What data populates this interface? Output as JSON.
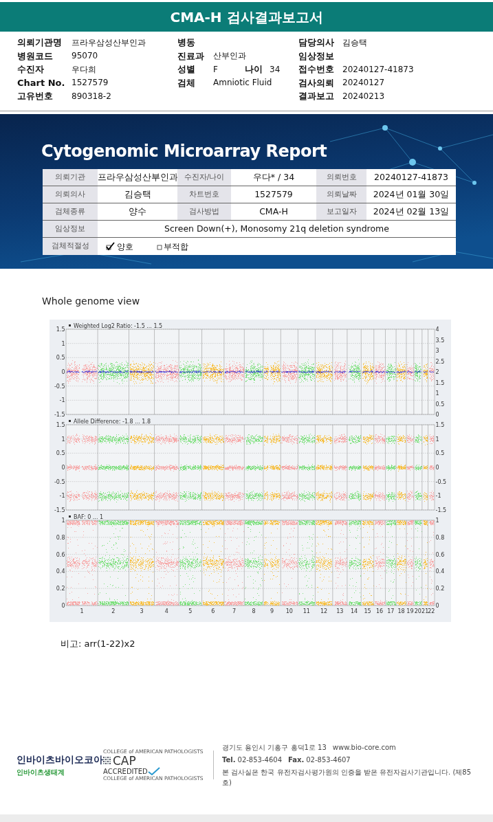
{
  "header": {
    "title": "CMA-H 검사결과보고서"
  },
  "info_columns": [
    {
      "rows": [
        {
          "label": "의뢰기관명",
          "value": "프라우삼성산부인과"
        },
        {
          "label": "병원코드",
          "value": "95070"
        },
        {
          "label": "수진자",
          "value": "우다희"
        },
        {
          "label": "Chart No.",
          "value": "1527579"
        },
        {
          "label": "고유번호",
          "value": "890318-2"
        }
      ]
    },
    {
      "rows": [
        {
          "label": "병동"
        },
        {
          "label": "진료과",
          "value": "산부인과"
        },
        {
          "label": "성별",
          "value": "F",
          "extra_label": "나이",
          "extra_value": "34"
        },
        {
          "label": "검체",
          "value": "Amniotic Fluid"
        }
      ]
    },
    {
      "rows": [
        {
          "label": "담당의사",
          "value": "김승택"
        },
        {
          "label": "임상정보"
        },
        {
          "label": "접수번호",
          "value": "20240127-41873"
        },
        {
          "label": "검사의뢰",
          "value": "20240127"
        },
        {
          "label": "결과보고",
          "value": "20240213"
        }
      ]
    }
  ],
  "report": {
    "title": "Cytogenomic Microarray Report",
    "rows": [
      {
        "cells": [
          {
            "label": "의뢰기관",
            "value": "프라우삼성산부인과"
          },
          {
            "label": "수진자/나이",
            "value": "우다* / 34"
          },
          {
            "label": "의뢰번호",
            "value": "20240127-41873"
          }
        ]
      },
      {
        "cells": [
          {
            "label": "의뢰의사",
            "value": "김승택"
          },
          {
            "label": "차트번호",
            "value": "1527579"
          },
          {
            "label": "의뢰날짜",
            "value": "2024년 01월 30일"
          }
        ]
      },
      {
        "cells": [
          {
            "label": "검체종류",
            "value": "양수"
          },
          {
            "label": "검사방법",
            "value": "CMA-H"
          },
          {
            "label": "보고일자",
            "value": "2024년 02월 13일"
          }
        ]
      },
      {
        "cells": [
          {
            "label": "임상정보",
            "value": "Screen Down(+), Monosomy 21q deletion syndrome"
          }
        ]
      }
    ],
    "suitability": {
      "label": "검체적절성",
      "options": [
        {
          "label": "양호",
          "checked": true
        },
        {
          "label": "부적합",
          "checked": false
        }
      ]
    }
  },
  "genome_view": {
    "title": "Whole genome view",
    "panels": [
      {
        "kind": "ratio",
        "title": "Weighted Log2 Ratio: -1.5 ... 1.5",
        "left_ticks": [
          "1.5",
          "1",
          "0.5",
          "0",
          "-0.5",
          "-1",
          "-1.5"
        ],
        "right_ticks": [
          "4",
          "3.5",
          "3",
          "2.5",
          "2",
          "1.5",
          "1",
          "0.5",
          "0"
        ]
      },
      {
        "kind": "allele",
        "title": "Allele Difference: -1.8 ... 1.8",
        "left_ticks": [
          "1.5",
          "1",
          "0.5",
          "0",
          "-0.5",
          "-1",
          "-1.5"
        ],
        "right_ticks": [
          "1.5",
          "1",
          "0.5",
          "0",
          "-0.5",
          "-1",
          "-1.5"
        ]
      },
      {
        "kind": "baf",
        "title": "BAF: 0 ... 1",
        "left_ticks": [
          "1",
          "0.8",
          "0.6",
          "0.4",
          "0.2",
          "0"
        ],
        "right_ticks": [
          "1",
          "0.8",
          "0.6",
          "0.4",
          "0.2",
          "0"
        ]
      }
    ],
    "chromosomes": [
      {
        "label": "1",
        "color": "#f7a8a8"
      },
      {
        "label": "2",
        "color": "#7ee07e"
      },
      {
        "label": "3",
        "color": "#f7c040"
      },
      {
        "label": "4",
        "color": "#f7a8a8"
      },
      {
        "label": "5",
        "color": "#7ee07e"
      },
      {
        "label": "6",
        "color": "#f7c040"
      },
      {
        "label": "7",
        "color": "#f7a8a8"
      },
      {
        "label": "8",
        "color": "#7ee07e"
      },
      {
        "label": "9",
        "color": "#f7c040"
      },
      {
        "label": "10",
        "color": "#f7a8a8"
      },
      {
        "label": "11",
        "color": "#7ee07e"
      },
      {
        "label": "12",
        "color": "#f7c040"
      },
      {
        "label": "13",
        "color": "#f7a8a8"
      },
      {
        "label": "14",
        "color": "#7ee07e"
      },
      {
        "label": "15",
        "color": "#f7c040"
      },
      {
        "label": "16",
        "color": "#f7a8a8"
      },
      {
        "label": "17",
        "color": "#7ee07e"
      },
      {
        "label": "18",
        "color": "#f7c040"
      },
      {
        "label": "19",
        "color": "#f7a8a8"
      },
      {
        "label": "20",
        "color": "#7ee07e"
      },
      {
        "label": "21",
        "color": "#f7c040"
      },
      {
        "label": "22",
        "color": "#f7a8a8"
      }
    ],
    "remark": "비고: arr(1-22)x2"
  },
  "footer": {
    "company": "인바이츠바이오코아",
    "company_sub": "인바이츠생태계",
    "cap_top": "COLLEGE of AMERICAN PATHOLOGISTS",
    "cap_name": "CAP",
    "cap_accredited": "ACCREDITED",
    "cap_bottom": "COLLEGE of AMERICAN PATHOLOGISTS",
    "address": "경기도 용인시 기흥구 흥덕1로 13",
    "website": "www.bio-core.com",
    "tel_label": "Tel.",
    "tel": "02-853-4604",
    "fax_label": "Fax.",
    "fax": "02-853-4607",
    "certification": "본 검사실은 한국 유전자검사평가원의 인증을 받은 유전자검사기관입니다. (제85호)"
  }
}
